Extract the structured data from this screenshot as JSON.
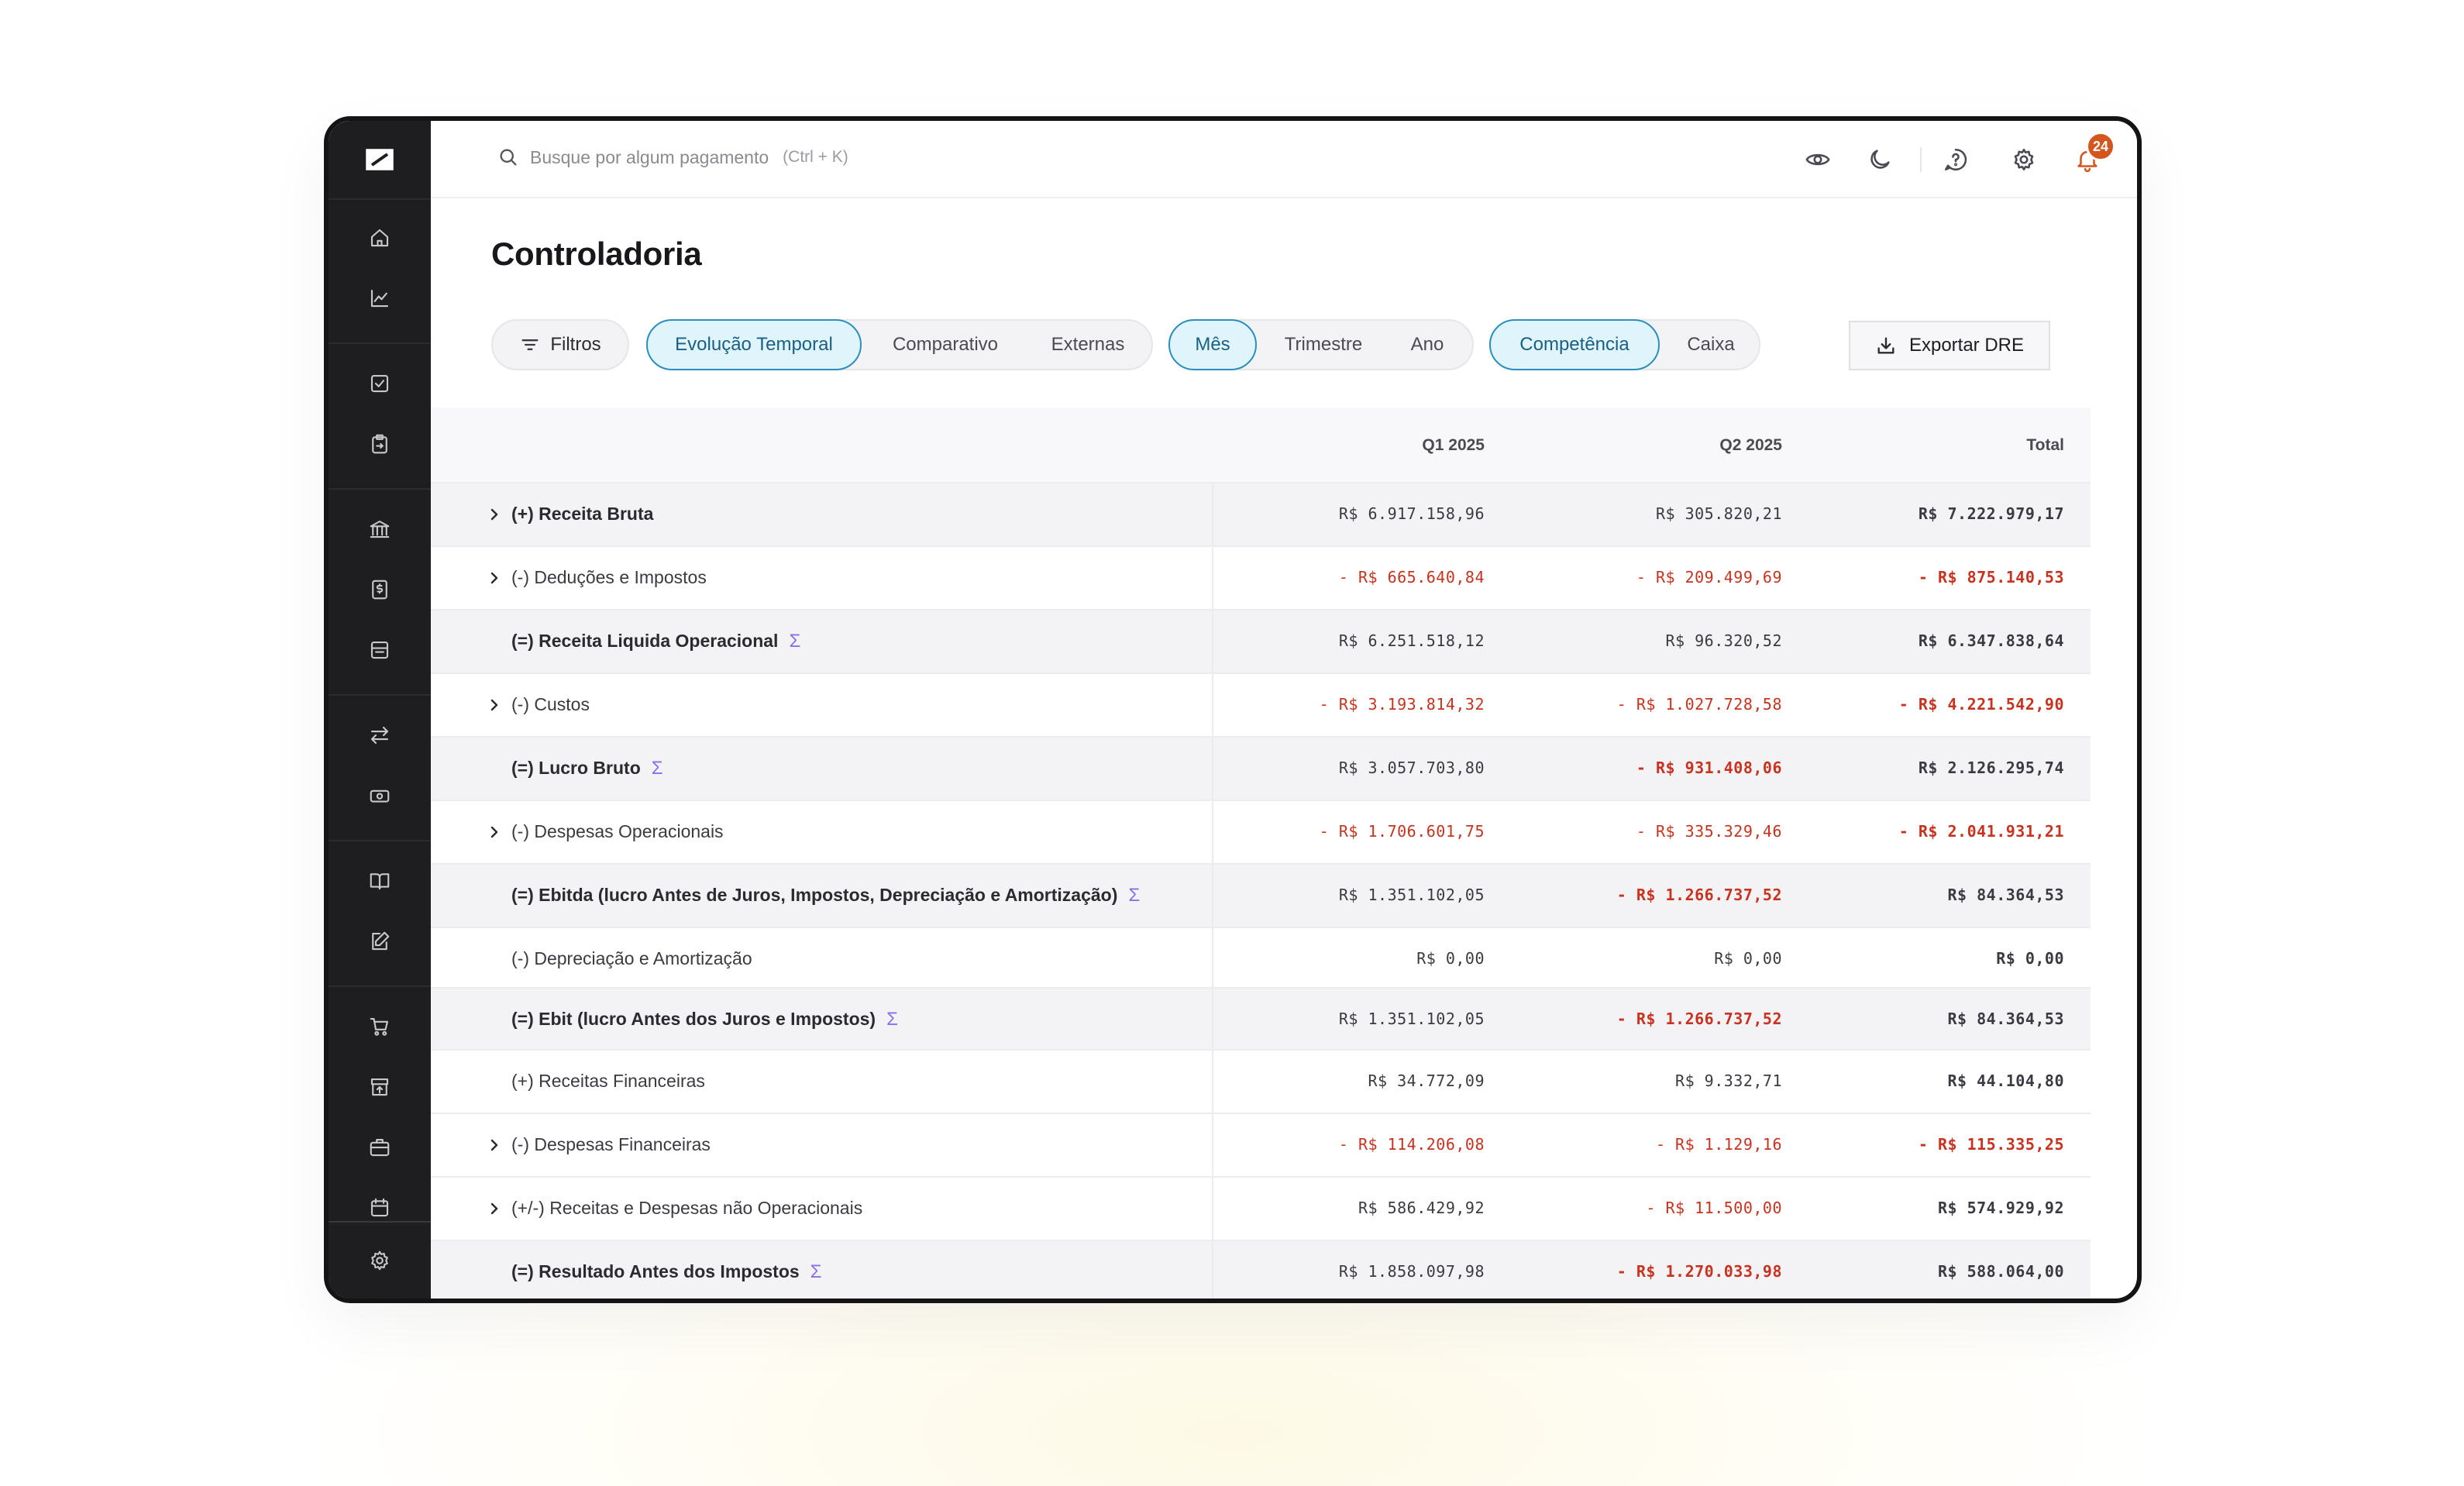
{
  "search": {
    "placeholder": "Busque por algum pagamento",
    "shortcut": "(Ctrl + K)"
  },
  "notifications": {
    "count": "24"
  },
  "page": {
    "title": "Controladoria"
  },
  "filters": {
    "label": "Filtros"
  },
  "view_tabs": [
    "Evolução Temporal",
    "Comparativo",
    "Externas"
  ],
  "period_tabs": [
    "Mês",
    "Trimestre",
    "Ano"
  ],
  "regime_tabs": [
    "Competência",
    "Caixa"
  ],
  "export": {
    "label": "Exportar DRE"
  },
  "table": {
    "columns": [
      "Q1 2025",
      "Q2 2025",
      "Total"
    ],
    "rows": [
      {
        "label": "(+) Receita Bruta",
        "q1": "R$ 6.917.158,96",
        "q2": "R$ 305.820,21",
        "total": "R$ 7.222.979,17"
      },
      {
        "label": "(-) Deduções e Impostos",
        "q1": "- R$ 665.640,84",
        "q2": "- R$ 209.499,69",
        "total": "- R$ 875.140,53"
      },
      {
        "label": "(=) Receita Liquida Operacional",
        "q1": "R$ 6.251.518,12",
        "q2": "R$ 96.320,52",
        "total": "R$ 6.347.838,64"
      },
      {
        "label": "(-) Custos",
        "q1": "- R$ 3.193.814,32",
        "q2": "- R$ 1.027.728,58",
        "total": "- R$ 4.221.542,90"
      },
      {
        "label": "(=) Lucro Bruto",
        "q1": "R$ 3.057.703,80",
        "q2": "- R$ 931.408,06",
        "total": "R$ 2.126.295,74"
      },
      {
        "label": "(-) Despesas Operacionais",
        "q1": "- R$ 1.706.601,75",
        "q2": "- R$ 335.329,46",
        "total": "- R$ 2.041.931,21"
      },
      {
        "label": "(=) Ebitda (lucro Antes de Juros, Impostos, Depreciação e Amortização)",
        "q1": "R$ 1.351.102,05",
        "q2": "- R$ 1.266.737,52",
        "total": "R$ 84.364,53"
      },
      {
        "label": "(-) Depreciação e Amortização",
        "q1": "R$ 0,00",
        "q2": "R$ 0,00",
        "total": "R$ 0,00"
      },
      {
        "label": "(=) Ebit (lucro Antes dos Juros e Impostos)",
        "q1": "R$ 1.351.102,05",
        "q2": "- R$ 1.266.737,52",
        "total": "R$ 84.364,53"
      },
      {
        "label": "(+) Receitas Financeiras",
        "q1": "R$ 34.772,09",
        "q2": "R$ 9.332,71",
        "total": "R$ 44.104,80"
      },
      {
        "label": "(-) Despesas Financeiras",
        "q1": "- R$ 114.206,08",
        "q2": "- R$ 1.129,16",
        "total": "- R$ 115.335,25"
      },
      {
        "label": "(+/-) Receitas e Despesas não Operacionais",
        "q1": "R$ 586.429,92",
        "q2": "- R$ 11.500,00",
        "total": "R$ 574.929,92"
      },
      {
        "label": "(=) Resultado Antes dos Impostos",
        "q1": "R$ 1.858.097,98",
        "q2": "- R$ 1.270.033,98",
        "total": "R$ 588.064,00"
      }
    ]
  },
  "colors": {
    "accent": "#2b8fbd",
    "negative": "#c8321f",
    "sigma": "#8b6fe6",
    "badge": "#d4561f"
  },
  "icons": {
    "sidebar": [
      "home-icon",
      "chart-icon",
      "task-icon",
      "clipboard-icon",
      "bank-icon",
      "invoice-icon",
      "inbox-icon",
      "transfer-icon",
      "cash-icon",
      "book-icon",
      "edit-icon",
      "cart-icon",
      "store-icon",
      "briefcase-icon",
      "calendar-icon",
      "settings-icon"
    ],
    "topbar": [
      "eye-icon",
      "moon-icon",
      "help-icon",
      "gear-icon",
      "bell-icon"
    ]
  }
}
